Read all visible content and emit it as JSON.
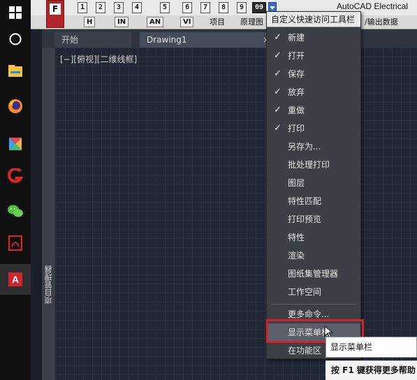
{
  "taskbar": {
    "icons": [
      "windows-start-icon",
      "cortana-circle-icon",
      "file-explorer-icon",
      "firefox-icon",
      "colorful-app-icon",
      "red-g-app-icon",
      "wechat-icon",
      "pdf-reader-icon",
      "autocad-icon"
    ]
  },
  "app": {
    "title": "AutoCAD Electrical",
    "logo_letter": "F",
    "quick_access_buttons": [
      "1",
      "2",
      "3",
      "4",
      "5",
      "6",
      "7",
      "8",
      "9",
      "09"
    ],
    "ribbon": {
      "box_h": "H",
      "box_in": "IN",
      "box_an": "AN",
      "box_vi": "VI",
      "tab_project": "项目",
      "tab_schematic": "原理图",
      "tab_export": "/输出数据"
    }
  },
  "tabs": {
    "start": "开始",
    "drawing": "Drawing1",
    "close": "×",
    "new": "+"
  },
  "side_panel": {
    "label": "项目管理器"
  },
  "viewport": {
    "label": "[−][俯视][二维线框]"
  },
  "menu": {
    "title": "自定义快速访问工具栏",
    "items": [
      {
        "label": "新建",
        "checked": "✓"
      },
      {
        "label": "打开",
        "checked": "✓"
      },
      {
        "label": "保存",
        "checked": "✓"
      },
      {
        "label": "放弃",
        "checked": "✓"
      },
      {
        "label": "重做",
        "checked": "✓"
      },
      {
        "label": "打印",
        "checked": "✓"
      },
      {
        "label": "另存为...",
        "checked": ""
      },
      {
        "label": "批处理打印",
        "checked": ""
      },
      {
        "label": "图层",
        "checked": ""
      },
      {
        "label": "特性匹配",
        "checked": ""
      },
      {
        "label": "打印预览",
        "checked": ""
      },
      {
        "label": "特性",
        "checked": ""
      },
      {
        "label": "渲染",
        "checked": ""
      },
      {
        "label": "图纸集管理器",
        "checked": ""
      },
      {
        "label": "工作空间",
        "checked": ""
      }
    ],
    "more": "更多命令...",
    "show_menubar": "显示菜单栏",
    "below_ribbon": "在功能区"
  },
  "tooltip": {
    "text": "显示菜单栏",
    "help": "按 F1 键获得更多帮助"
  }
}
